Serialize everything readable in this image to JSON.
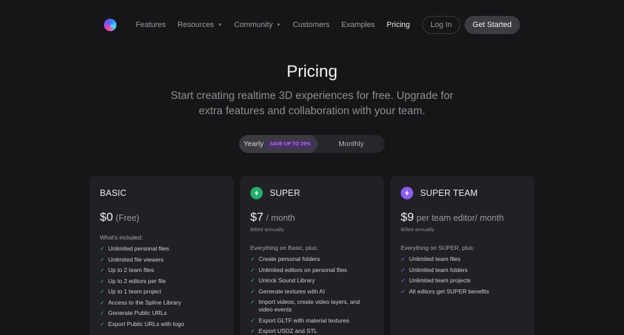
{
  "nav": {
    "links": [
      {
        "label": "Features",
        "dropdown": false,
        "active": false
      },
      {
        "label": "Resources",
        "dropdown": true,
        "active": false
      },
      {
        "label": "Community",
        "dropdown": true,
        "active": false
      },
      {
        "label": "Customers",
        "dropdown": false,
        "active": false
      },
      {
        "label": "Examples",
        "dropdown": false,
        "active": false
      },
      {
        "label": "Pricing",
        "dropdown": false,
        "active": true
      }
    ],
    "login_label": "Log In",
    "cta_label": "Get Started"
  },
  "hero": {
    "title": "Pricing",
    "subtitle_line1": "Start creating realtime 3D experiences for free. Upgrade for",
    "subtitle_line2": "extra features and collaboration with your team."
  },
  "billing_toggle": {
    "yearly_label": "Yearly",
    "save_badge": "SAVE UP TO 25%",
    "monthly_label": "Monthly",
    "selected": "yearly"
  },
  "colors": {
    "background": "#161619",
    "card": "#212125",
    "super_icon": "#1fae6b",
    "team_icon": "#8a5cf5",
    "check_green": "#38c985",
    "check_purple": "#9d7bff"
  },
  "plans": [
    {
      "name": "BASIC",
      "icon": "",
      "price": "$0",
      "period": "(Free)",
      "billed": "",
      "included_label": "What's included:",
      "features": [
        "Unlimited personal files",
        "Unlimited file viewers",
        "Up to 2 team files",
        "Up to 2 editors per file",
        "Up to 1 team project",
        "Access to the Spline Library",
        "Generate Public URLs",
        "Export Public URLs with logo"
      ]
    },
    {
      "name": "SUPER",
      "icon": "lightning-icon",
      "price": "$7",
      "period": "/ month",
      "billed": "Billed annually",
      "included_label": "Everything on Basic, plus:",
      "features": [
        "Create personal folders",
        "Unlimited editors on personal files",
        "Unlock Sound Library",
        "Generate textures with AI",
        "Import videos, create video layers, and video events",
        "Export GLTF with material textures",
        "Export USDZ and STL"
      ]
    },
    {
      "name": "SUPER TEAM",
      "icon": "lightning-icon",
      "price": "$9",
      "period": "per team editor/ month",
      "billed": "Billed annually",
      "included_label": "Everything on SUPER, plus:",
      "features": [
        "Unlimited team files",
        "Unlimited team folders",
        "Unlimited team projects",
        "All editors get SUPER benefits"
      ]
    }
  ]
}
